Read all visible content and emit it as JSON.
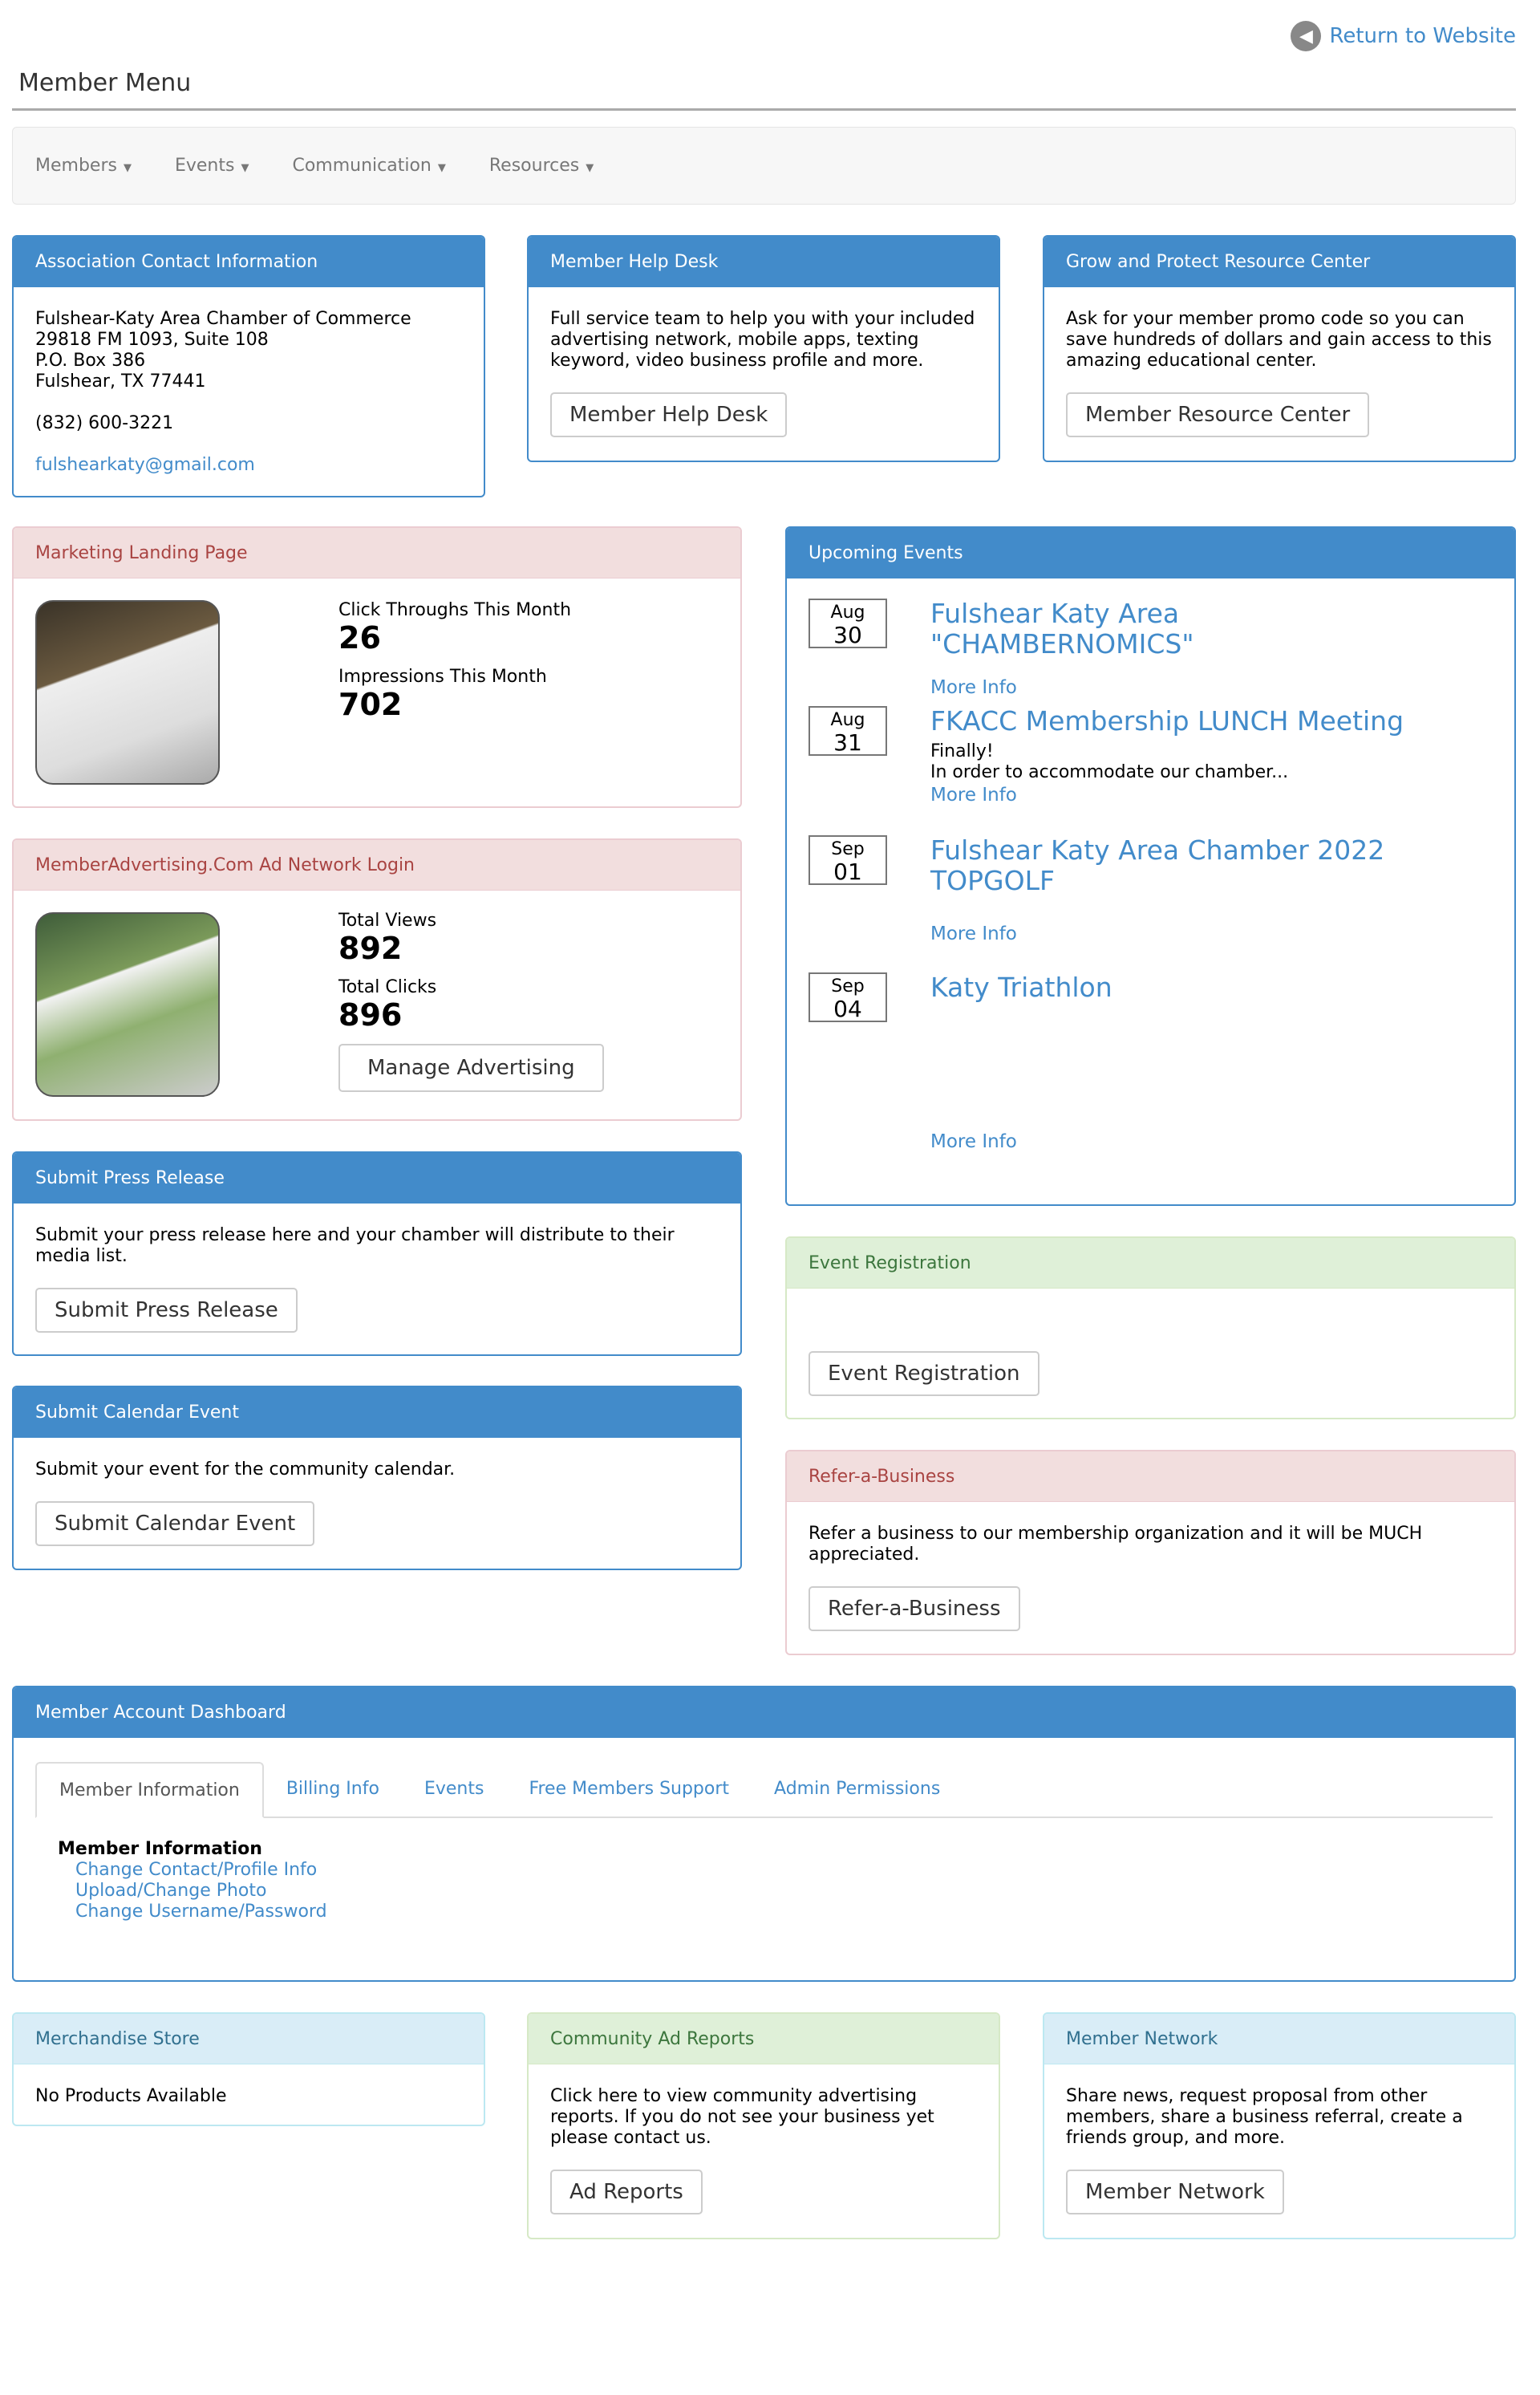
{
  "header": {
    "return_label": "Return to Website",
    "menu_title": "Member Menu"
  },
  "nav": [
    {
      "label": "Members"
    },
    {
      "label": "Events"
    },
    {
      "label": "Communication"
    },
    {
      "label": "Resources"
    }
  ],
  "contact": {
    "title": "Association Contact Information",
    "org": "Fulshear-Katy Area Chamber of Commerce",
    "address1": "29818 FM 1093, Suite 108",
    "address2": "P.O. Box 386",
    "city": "Fulshear, TX 77441",
    "phone": "(832) 600-3221",
    "email": "fulshearkaty@gmail.com"
  },
  "helpdesk": {
    "title": "Member Help Desk",
    "text": "Full service team to help you with your included advertising network, mobile apps, texting keyword, video business profile and more.",
    "button": "Member Help Desk"
  },
  "resource": {
    "title": "Grow and Protect Resource Center",
    "text": "Ask for your member promo code so you can save hundreds of dollars and gain access to this amazing educational center.",
    "button": "Member Resource Center"
  },
  "landing": {
    "title": "Marketing Landing Page",
    "click_label": "Click Throughs This Month",
    "click_value": "26",
    "impr_label": "Impressions This Month",
    "impr_value": "702"
  },
  "adnet": {
    "title": "MemberAdvertising.Com Ad Network Login",
    "views_label": "Total Views",
    "views_value": "892",
    "clicks_label": "Total Clicks",
    "clicks_value": "896",
    "button": "Manage Advertising"
  },
  "press": {
    "title": "Submit Press Release",
    "text": "Submit your press release here and your chamber will distribute to their media list.",
    "button": "Submit Press Release"
  },
  "calendar": {
    "title": "Submit Calendar Event",
    "text": "Submit your event for the community calendar.",
    "button": "Submit Calendar Event"
  },
  "events": {
    "title": "Upcoming Events",
    "items": [
      {
        "month": "Aug",
        "day": "30",
        "title": "Fulshear Katy Area \"CHAMBERNOMICS\"",
        "more": "More Info"
      },
      {
        "month": "Aug",
        "day": "31",
        "title": "FKACC Membership LUNCH Meeting",
        "desc1": "Finally!",
        "desc2": "In order to accommodate our chamber...",
        "more": "More Info"
      },
      {
        "month": "Sep",
        "day": "01",
        "title": "Fulshear Katy Area Chamber 2022 TOPGOLF",
        "more": "More Info"
      },
      {
        "month": "Sep",
        "day": "04",
        "title": "Katy Triathlon",
        "more": "More Info"
      }
    ]
  },
  "eventreg": {
    "title": "Event Registration",
    "button": "Event Registration"
  },
  "refer": {
    "title": "Refer-a-Business",
    "text": "Refer a business to our membership organization and it will be MUCH appreciated.",
    "button": "Refer-a-Business"
  },
  "dashboard": {
    "title": "Member Account Dashboard",
    "tabs": [
      "Member Information",
      "Billing Info",
      "Events",
      "Free Members Support",
      "Admin Permissions"
    ],
    "section": "Member Information",
    "links": [
      "Change Contact/Profile Info",
      "Upload/Change Photo",
      "Change Username/Password"
    ]
  },
  "store": {
    "title": "Merchandise Store",
    "text": "No Products Available"
  },
  "adreports": {
    "title": "Community Ad Reports",
    "text": "Click here to view community advertising reports. If you do not see your business yet please contact us.",
    "button": "Ad Reports"
  },
  "network": {
    "title": "Member Network",
    "text": "Share news, request proposal from other members, share a business referral, create a friends group, and more.",
    "button": "Member Network"
  }
}
